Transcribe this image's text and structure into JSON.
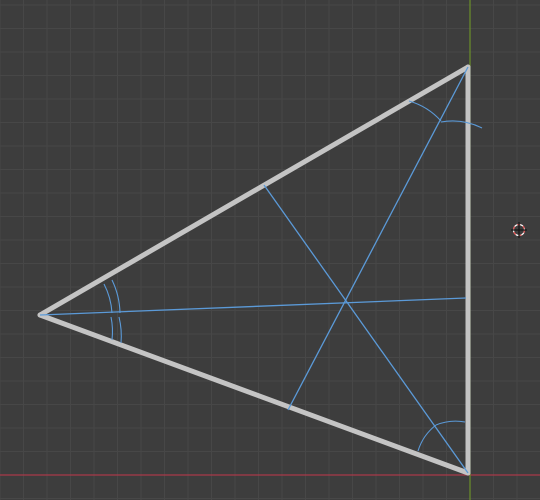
{
  "viewport": {
    "background": "#3d3d3d",
    "grid": true,
    "grid_color_minor": "#474747",
    "grid_color_major": "#4d4d4d",
    "x_axis_color": "#a83a4a",
    "y_axis_color": "#6a8f2a"
  },
  "triangle": {
    "edge_color": "#c4c4c4",
    "vertices": [
      "left",
      "top-right",
      "bottom-right"
    ]
  },
  "construction": {
    "bisector_color": "#5b9ad8",
    "bisector_count": 3,
    "angle_arc_marks": [
      {
        "vertex": "left",
        "arcs_per_half": 2
      },
      {
        "vertex": "top-right",
        "arcs_per_half": 1
      },
      {
        "vertex": "bottom-right",
        "arcs_per_half": 1
      }
    ]
  },
  "cursor": {
    "icon": "3d-cursor-icon",
    "ring_colors": [
      "#ffffff",
      "#e04848"
    ]
  }
}
